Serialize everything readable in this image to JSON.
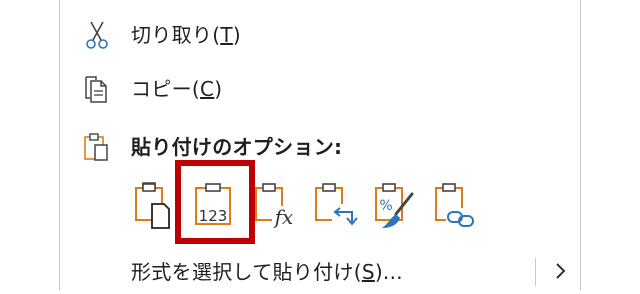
{
  "menu": {
    "cut": {
      "text": "切り取り(",
      "key": "T",
      "end": ")"
    },
    "copy": {
      "text": "コピー(",
      "key": "C",
      "end": ")"
    },
    "paste_options_header": "貼り付けのオプション:",
    "paste_options": [
      {
        "icon": "paste-keep-source-formatting-icon"
      },
      {
        "icon": "paste-values-icon",
        "text": "123",
        "highlighted": true
      },
      {
        "icon": "paste-formulas-icon",
        "text": "fx"
      },
      {
        "icon": "paste-transpose-icon"
      },
      {
        "icon": "paste-formatting-icon",
        "text": "%"
      },
      {
        "icon": "paste-link-icon"
      }
    ],
    "paste_special": {
      "text": "形式を選択して貼り付け(",
      "key": "S",
      "end": ")..."
    }
  },
  "colors": {
    "accent_orange": "#e07b1a",
    "icon_gray": "#444444",
    "highlight_red": "#c00000",
    "blue": "#2e75b6"
  }
}
